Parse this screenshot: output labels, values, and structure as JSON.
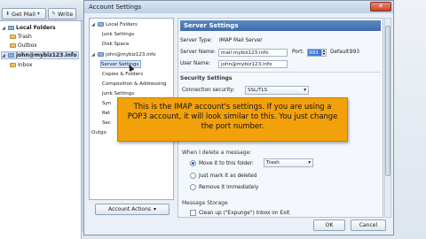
{
  "main_window": {
    "toolbar": {
      "get_mail": "Get Mail",
      "write": "Write"
    },
    "folders": [
      {
        "label": "Local Folders",
        "level": 0,
        "bold": true
      },
      {
        "label": "Trash",
        "level": 1,
        "bold": false
      },
      {
        "label": "Outbox",
        "level": 1,
        "bold": false
      },
      {
        "label": "john@mybiz123.info",
        "level": 0,
        "bold": true
      },
      {
        "label": "Inbox",
        "level": 1,
        "bold": false
      }
    ]
  },
  "dialog": {
    "title": "Account Settings",
    "close_glyph": "✕",
    "tree": [
      {
        "label": "Local Folders",
        "level": 0
      },
      {
        "label": "Junk Settings",
        "level": 1
      },
      {
        "label": "Disk Space",
        "level": 1
      },
      {
        "label": "john@mybiz123.info",
        "level": 0
      },
      {
        "label": "Server Settings",
        "level": 1,
        "selected": true
      },
      {
        "label": "Copies & Folders",
        "level": 1
      },
      {
        "label": "Composition & Addressing",
        "level": 1
      },
      {
        "label": "Junk Settings",
        "level": 1
      },
      {
        "label": "Syn",
        "level": 1
      },
      {
        "label": "Ret",
        "level": 1
      },
      {
        "label": "Sec",
        "level": 1
      },
      {
        "label": "Outgo",
        "level": 0
      }
    ],
    "account_actions": "Account Actions",
    "panel": {
      "heading": "Server Settings",
      "server_type_label": "Server Type:",
      "server_type_value": "IMAP Mail Server",
      "server_name_label": "Server Name:",
      "server_name_value": "mail.mybiz123.info",
      "port_label": "Port:",
      "port_value": "993",
      "default_label": "Default:",
      "default_value": "993",
      "user_name_label": "User Name:",
      "user_name_value": "john@mybiz123.info",
      "security_section": "Security Settings",
      "connection_security_label": "Connection security:",
      "connection_security_value": "SSL/TLS",
      "delete_section": "When I delete a message:",
      "delete_options": [
        {
          "label": "Move it to this folder:",
          "checked": true
        },
        {
          "label": "Just mark it as deleted",
          "checked": false
        },
        {
          "label": "Remove it immediately",
          "checked": false
        }
      ],
      "trash_folder": "Trash",
      "storage_section": "Message Storage",
      "clean_up_label": "Clean up (\"Expunge\") Inbox on Exit"
    },
    "ok_label": "OK",
    "cancel_label": "Cancel"
  },
  "callout": {
    "text": "This is the IMAP account's settings. If you are using a POP3 account, it will look similar to this. You just change the port number."
  }
}
